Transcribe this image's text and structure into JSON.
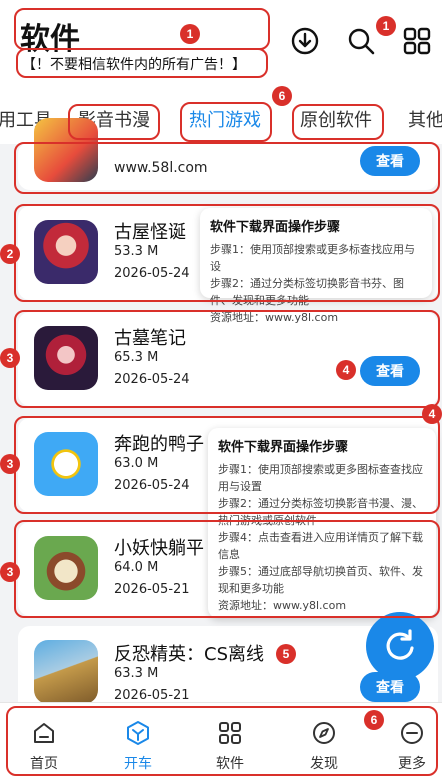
{
  "header": {
    "title": "软件",
    "notice": "【！不要相信软件内的所有广告！】"
  },
  "tabs": [
    {
      "label": "用工具"
    },
    {
      "label": "影音书漫"
    },
    {
      "label": "热门游戏"
    },
    {
      "label": "原创软件"
    },
    {
      "label": "其他"
    }
  ],
  "badges": [
    "1",
    "1",
    "6",
    "2",
    "3",
    "4",
    "4",
    "3",
    "3",
    "5",
    "6"
  ],
  "apps": [
    {
      "name": "",
      "size": "",
      "date": "",
      "url": "www.58l.com",
      "button": "查看"
    },
    {
      "name": "古屋怪诞",
      "size": "53.3 M",
      "date": "2026-05-24",
      "button": "查看"
    },
    {
      "name": "古墓笔记",
      "size": "65.3 M",
      "date": "2026-05-24",
      "button": "查看"
    },
    {
      "name": "奔跑的鸭子",
      "size": "63.0 M",
      "date": "2026-05-24",
      "button": "查看"
    },
    {
      "name": "小妖快躺平",
      "size": "64.0 M",
      "date": "2026-05-21",
      "button": "查看"
    },
    {
      "name": "反恐精英：CS离线",
      "size": "63.3 M",
      "date": "2026-05-21",
      "button": "查看"
    }
  ],
  "tip1": {
    "title": "软件下载界面操作步骤",
    "lines": [
      "步骤1：使用顶部搜索或更多标查找应用与设",
      "步骤2：通过分类标签切换影音书芬、图件、发现和更多功能",
      "资源地址：www.y8l.com"
    ]
  },
  "tip2": {
    "title": "软件下载界面操作步骤",
    "lines": [
      "步骤1：使用顶部搜索或更多图标查查找应用与设置",
      "步骤2：通过分类标签切换影音书漫、漫、热门游戏或原创软件",
      "步骤4：点击查看进入应用详情页了解下载信息",
      "步骤5：通过底部导航切换首页、软件、发现和更多功能",
      "资源地址：www.y8l.com"
    ]
  },
  "nav": [
    {
      "label": "首页",
      "icon": "home-icon"
    },
    {
      "label": "开车",
      "icon": "drive-icon"
    },
    {
      "label": "软件",
      "icon": "grid-icon"
    },
    {
      "label": "发现",
      "icon": "compass-icon"
    },
    {
      "label": "更多",
      "icon": "more-icon"
    }
  ],
  "colors": {
    "accent": "#1a88e8",
    "annotation": "#d9302a"
  }
}
